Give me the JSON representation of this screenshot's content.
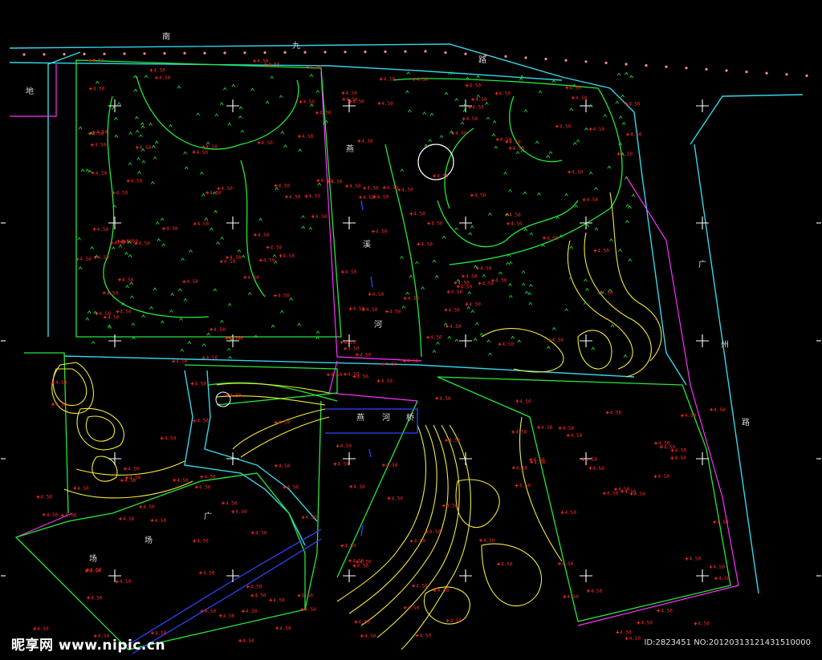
{
  "drawing": {
    "background": "#000000",
    "colors": {
      "boundary": "#ff2fff",
      "road_edge": "#35d6e8",
      "green": "#25e83a",
      "contour": "#f2ea38",
      "elevation": "#ff2a2a",
      "water": "#2f45ff",
      "cross_marks": "#ffffff"
    },
    "labels": {
      "road_top_1": "南",
      "road_top_2": "九",
      "road_top_3": "路",
      "canal_1": "燕",
      "canal_2": "溪",
      "canal_3": "河",
      "road_right_1": "广",
      "road_right_2": "州",
      "road_right_3": "路",
      "left_edge": "地",
      "bridge_1": "燕",
      "bridge_2": "河",
      "bridge_3": "桥",
      "lower_1": "广",
      "lower_2": "场",
      "lower_3": "场"
    },
    "elevation_mark_text": "4.50"
  },
  "watermark": {
    "logo": "昵享网 www.nipic.cn",
    "id_text": "ID:2823451 NO:20120313121431510000"
  }
}
